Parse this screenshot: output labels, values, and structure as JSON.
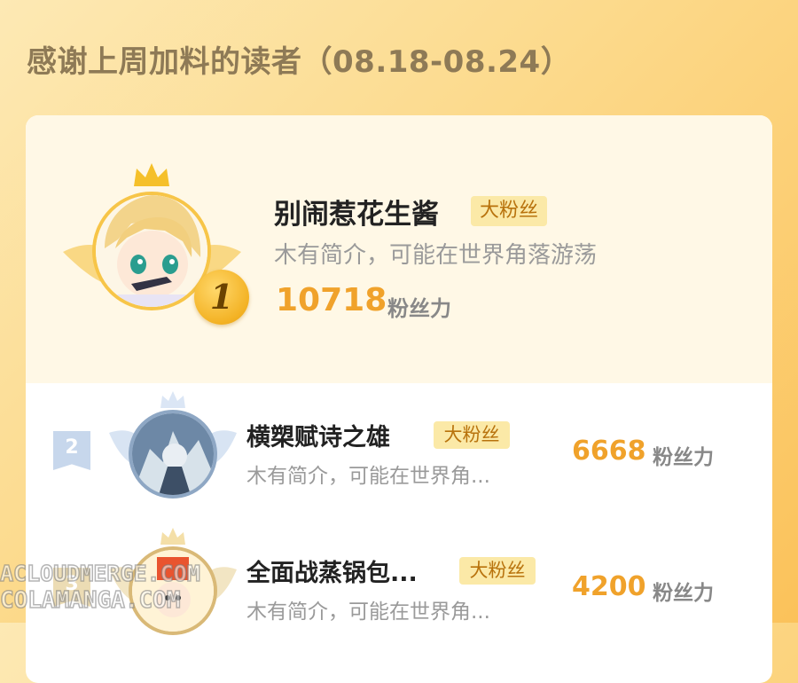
{
  "header": {
    "title": "感谢上周加料的读者（08.18-08.24）"
  },
  "readers": [
    {
      "rank": "1",
      "name": "别闹惹花生酱",
      "badge": "大粉丝",
      "bio": "木有简介，可能在世界角落游荡",
      "score": "10718",
      "score_unit": "粉丝力"
    },
    {
      "rank": "2",
      "name": "横槊赋诗之雄",
      "badge": "大粉丝",
      "bio": "木有简介，可能在世界角...",
      "score": "6668",
      "score_unit": "粉丝力"
    },
    {
      "rank": "3",
      "name": "全面战蒸锅包...",
      "badge": "大粉丝",
      "bio": "木有简介，可能在世界角...",
      "score": "4200",
      "score_unit": "粉丝力"
    }
  ],
  "watermark": {
    "line1": "ACLOUDMERGE.COM",
    "line2": "COLAMANGA.COM"
  },
  "colors": {
    "accent": "#f0a22b",
    "badge_bg": "#fbe9a7",
    "badge_text": "#b8720c",
    "title": "#8e7a56"
  },
  "icons": {
    "crown_gold": "crown-icon",
    "crown_silver": "crown-icon",
    "wing": "wing-icon"
  }
}
